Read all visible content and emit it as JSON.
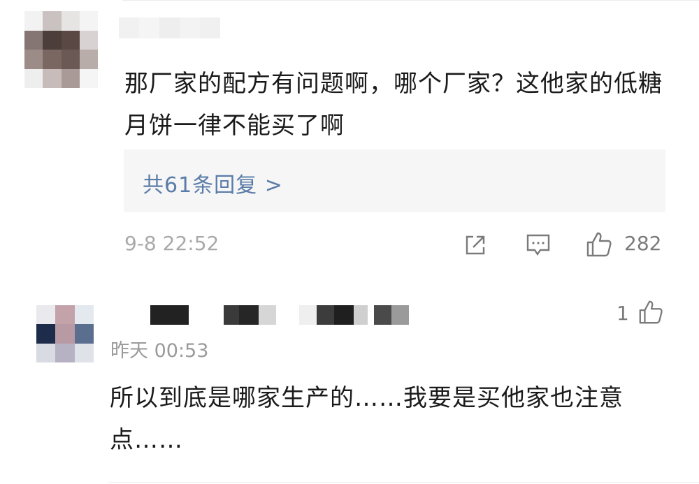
{
  "comments": [
    {
      "text": "那厂家的配方有问题啊，哪个厂家？这他家的低糖月饼一律不能买了啊",
      "replies_link": "共61条回复 >",
      "time": "9-8 22:52",
      "like_count": "282",
      "icons": [
        "share-icon",
        "comment-icon",
        "thumbs-up-icon"
      ]
    },
    {
      "time": "昨天 00:53",
      "like_count": "1",
      "text": "所以到底是哪家生产的……我要是买他家也注意点……",
      "icons": [
        "thumbs-up-icon"
      ]
    }
  ],
  "colors": {
    "link": "#5a7ca8",
    "meta": "#a9a9a9",
    "reply_box_bg": "#f6f6f6"
  }
}
